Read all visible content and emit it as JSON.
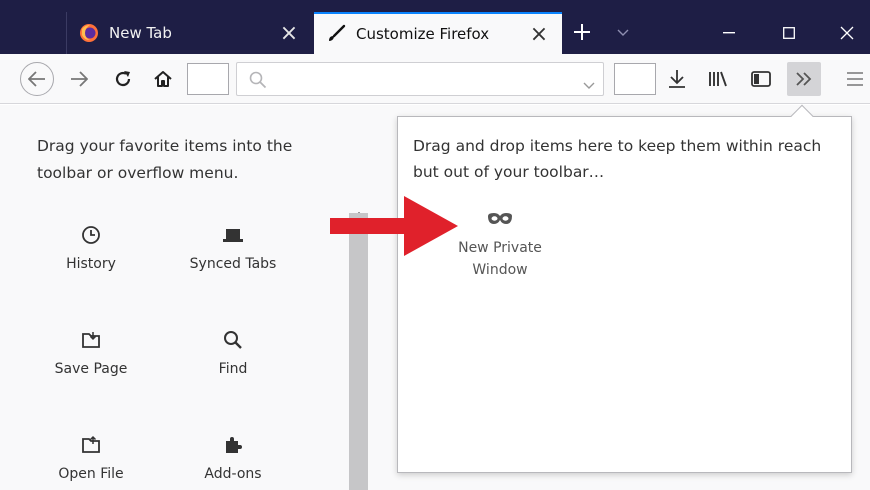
{
  "tabs": [
    {
      "label": "New Tab",
      "active": false
    },
    {
      "label": "Customize Firefox",
      "active": true
    }
  ],
  "toolbar": {
    "search_placeholder": ""
  },
  "palette": {
    "intro": "Drag your favorite items into the toolbar or overflow menu.",
    "items": [
      {
        "label": "History",
        "icon": "clock-icon"
      },
      {
        "label": "Synced Tabs",
        "icon": "laptop-icon"
      },
      {
        "label": "Save Page",
        "icon": "save-page-icon"
      },
      {
        "label": "Find",
        "icon": "magnifier-icon"
      },
      {
        "label": "Open File",
        "icon": "open-file-icon"
      },
      {
        "label": "Add-ons",
        "icon": "puzzle-icon"
      }
    ]
  },
  "overflow_panel": {
    "intro": "Drag and drop items here to keep them within reach but out of your toolbar…",
    "items": [
      {
        "label": "New Private Window",
        "icon": "private-mask-icon"
      }
    ]
  },
  "colors": {
    "tabbar": "#1e1e45",
    "accent": "#0a84ff",
    "annotation_arrow": "#e0212b"
  }
}
